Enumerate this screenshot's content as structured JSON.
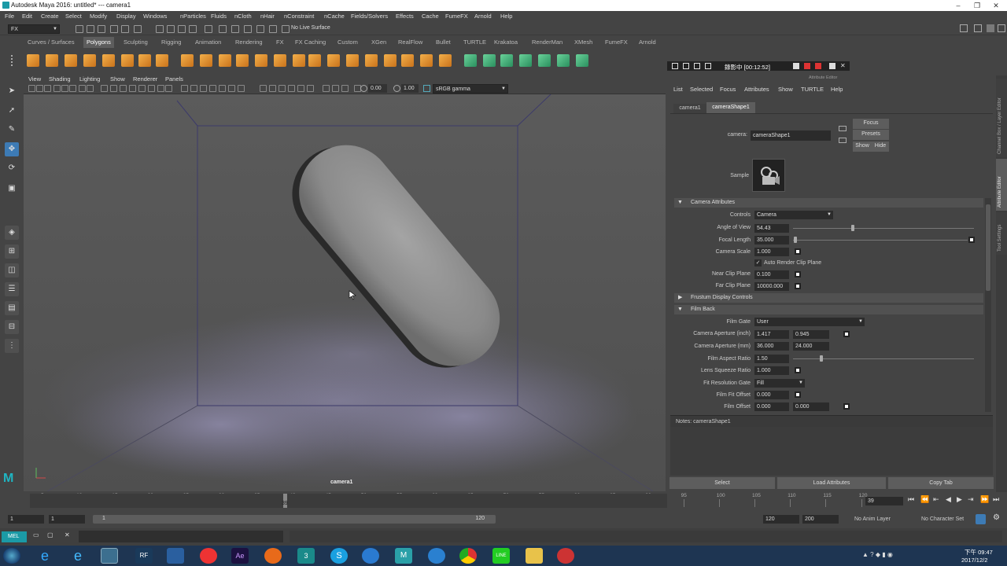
{
  "window": {
    "title": "Autodesk Maya 2016: untitled*   ---   camera1"
  },
  "menu": [
    "File",
    "Edit",
    "Create",
    "Select",
    "Modify",
    "Display",
    "Windows",
    "nParticles",
    "Fluids",
    "nCloth",
    "nHair",
    "nConstraint",
    "nCache",
    "Fields/Solvers",
    "Effects",
    "Cache",
    "FumeFX",
    "Arnold",
    "Help"
  ],
  "status": {
    "menuset": "FX",
    "live_surface": "No Live Surface"
  },
  "shelf_tabs": [
    "Curves / Surfaces",
    "Polygons",
    "Sculpting",
    "Rigging",
    "Animation",
    "Rendering",
    "FX",
    "FX Caching",
    "Custom",
    "XGen",
    "RealFlow",
    "Bullet",
    "TURTLE",
    "Krakatoa",
    "RenderMan",
    "XMesh",
    "FumeFX",
    "Arnold"
  ],
  "shelf_active": "Polygons",
  "viewport": {
    "menu": [
      "View",
      "Shading",
      "Lighting",
      "Show",
      "Renderer",
      "Panels"
    ],
    "exposure": "0.00",
    "gamma": "1.00",
    "color_space": "sRGB gamma",
    "camera_label": "camera1"
  },
  "ae_window": {
    "timer": "錄影中 [00:12:52]",
    "title": "Attribute Editor"
  },
  "attribute_editor": {
    "menu": [
      "List",
      "Selected",
      "Focus",
      "Attributes",
      "Show",
      "TURTLE",
      "Help"
    ],
    "tabs": [
      "camera1",
      "cameraShape1"
    ],
    "node_label": "camera:",
    "node_name": "cameraShape1",
    "buttons": {
      "focus": "Focus",
      "presets": "Presets",
      "show": "Show",
      "hide": "Hide"
    },
    "sample_label": "Sample",
    "sections": {
      "camera": "Camera Attributes",
      "frustum": "Frustum Display Controls",
      "filmback": "Film Back"
    },
    "camera_attrs": {
      "controls_label": "Controls",
      "controls_value": "Camera",
      "aov_label": "Angle of View",
      "aov_value": "54.43",
      "focal_label": "Focal Length",
      "focal_value": "35.000",
      "scale_label": "Camera Scale",
      "scale_value": "1.000",
      "auto_clip": "Auto Render Clip Plane",
      "near_label": "Near Clip Plane",
      "near_value": "0.100",
      "far_label": "Far Clip Plane",
      "far_value": "10000.000"
    },
    "film_back": {
      "gate_label": "Film Gate",
      "gate_value": "User",
      "ap_inch_label": "Camera Aperture (inch)",
      "ap_inch": [
        "1.417",
        "0.945"
      ],
      "ap_mm_label": "Camera Aperture (mm)",
      "ap_mm": [
        "36.000",
        "24.000"
      ],
      "aspect_label": "Film Aspect Ratio",
      "aspect_value": "1.50",
      "squeeze_label": "Lens Squeeze Ratio",
      "squeeze_value": "1.000",
      "fit_gate_label": "Fit Resolution Gate",
      "fit_gate_value": "Fill",
      "fit_offset_label": "Film Fit Offset",
      "fit_offset_value": "0.000",
      "offset_label": "Film Offset",
      "offset_values": [
        "0.000",
        "0.000"
      ]
    },
    "notes": "Notes:  cameraShape1",
    "bottom_buttons": [
      "Select",
      "Load Attributes",
      "Copy Tab"
    ],
    "side_tabs": [
      "Channel Box / Layer Editor",
      "Attribute Editor",
      "Tool Settings"
    ]
  },
  "timeline": {
    "ticks": [
      "5",
      "10",
      "15",
      "20",
      "25",
      "30",
      "35",
      "40",
      "45",
      "50",
      "55",
      "60",
      "65",
      "70",
      "75",
      "80",
      "85",
      "90",
      "95",
      "100",
      "105",
      "110",
      "115",
      "120"
    ],
    "current": "39",
    "current_field": "39"
  },
  "range": {
    "start": "1",
    "play_start": "1",
    "range_start": "1",
    "range_end": "120",
    "play_end": "120",
    "end": "200",
    "anim_layer": "No Anim Layer",
    "char_set": "No Character Set"
  },
  "cmdline": {
    "lang": "MEL"
  },
  "taskbar": {
    "time": "下午 09:47",
    "date": "2017/12/2"
  }
}
